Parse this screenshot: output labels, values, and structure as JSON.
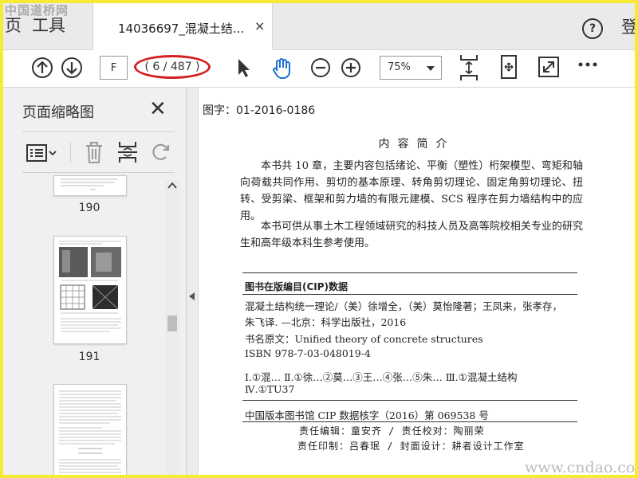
{
  "watermarks": {
    "top": "中国道桥网",
    "bottom": "www.cndao.com"
  },
  "tabbar": {
    "left_cut_label": "页",
    "tools_tab": "工具",
    "document_tab_title": "14036697_混凝土结...",
    "close_glyph": "×",
    "help_glyph": "?",
    "login_label": "登"
  },
  "toolbar": {
    "page_input_value": "F",
    "page_count": "( 6 / 487 )",
    "zoom": "75%",
    "icons": [
      "prev-page-icon",
      "next-page-icon",
      "select-cursor-icon",
      "hand-tool-icon",
      "zoom-out-icon",
      "zoom-in-icon",
      "page-fit-icon",
      "rotate-fit-icon",
      "fullscreen-icon",
      "more-icon"
    ],
    "highlight_color": "#d42020"
  },
  "sidebar": {
    "title": "页面缩略图",
    "close_glyph": "✕",
    "tools": [
      "thumbnail-options-icon",
      "delete-page-icon",
      "extract-page-icon",
      "rotate-page-icon"
    ],
    "thumbnails": [
      {
        "page": "190"
      },
      {
        "page": "191"
      }
    ]
  },
  "document": {
    "header": "图字：01-2016-0186",
    "title": "内容简介",
    "paragraphs": [
      "本书共 10 章，主要内容包括绪论、平衡（塑性）桁架模型、弯矩和轴向荷载共同作用、剪切的基本原理、转角剪切理论、固定角剪切理论、扭转、受剪梁、框架和剪力墙的有限元建模、SCS 程序在剪力墙结构中的应用。",
      "本书可供从事土木工程领域研究的科技人员及高等院校相关专业的研究生和高年级本科生参考使用。"
    ],
    "cip_heading": "图书在版编目(CIP)数据",
    "cip_lines": [
      "混凝土结构统一理论/（美）徐增全，（美）莫怡隆著；王凤来，张孝存，",
      "朱飞译. —北京：科学出版社，2016",
      "书名原文：Unified theory of concrete structures",
      "ISBN 978-7-03-048019-4",
      "Ⅰ.①混…  Ⅱ.①徐…②莫…③王…④张…⑤朱…   Ⅲ.①混凝土结构",
      "Ⅳ.①TU37"
    ],
    "cip_number": "中国版本图书馆 CIP 数据核字（2016）第 069538 号",
    "credits": [
      "责任编辑：童安齐 / 责任校对：陶丽荣",
      "责任印制：吕春珉 / 封面设计：耕者设计工作室"
    ]
  }
}
